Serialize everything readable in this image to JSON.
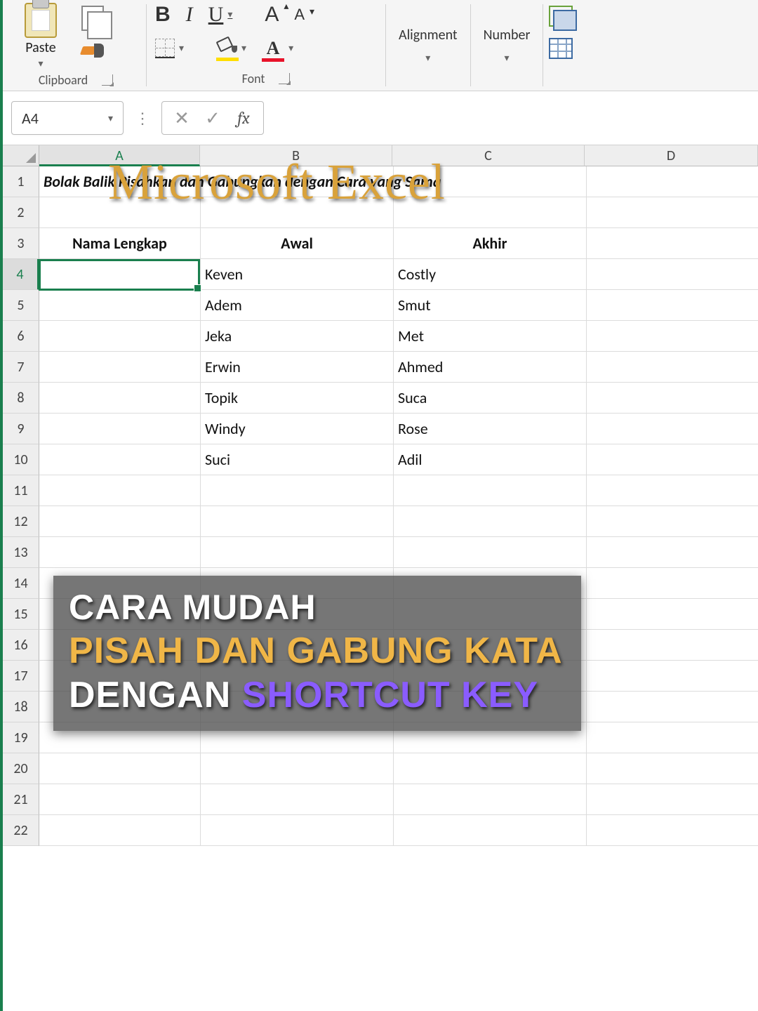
{
  "ribbon": {
    "paste_label": "Paste",
    "clipboard_label": "Clipboard",
    "bold": "B",
    "italic": "I",
    "underline": "U",
    "grow_font": "A",
    "shrink_font": "A",
    "font_color_letter": "A",
    "font_label": "Font",
    "alignment_label": "Alignment",
    "number_label": "Number"
  },
  "formula_bar": {
    "namebox_value": "A4",
    "cancel": "✕",
    "enter": "✓",
    "fx": "fx",
    "formula_value": ""
  },
  "overlay_title": "Microsoft Excel",
  "columns": [
    "A",
    "B",
    "C",
    "D"
  ],
  "sheet": {
    "row1": {
      "A": "Bolak Balik Pisahkan dan Gabungkan dengan Cara yang Sama"
    },
    "row3": {
      "A": "Nama Lengkap",
      "B": "Awal",
      "C": "Akhir"
    },
    "data_rows": [
      {
        "n": "4",
        "A": "",
        "B": "Keven",
        "C": "Costly"
      },
      {
        "n": "5",
        "A": "",
        "B": "Adem",
        "C": "Smut"
      },
      {
        "n": "6",
        "A": "",
        "B": "Jeka",
        "C": "Met"
      },
      {
        "n": "7",
        "A": "",
        "B": "Erwin",
        "C": "Ahmed"
      },
      {
        "n": "8",
        "A": "",
        "B": "Topik",
        "C": "Suca"
      },
      {
        "n": "9",
        "A": "",
        "B": "Windy",
        "C": "Rose"
      },
      {
        "n": "10",
        "A": "",
        "B": "Suci",
        "C": "Adil"
      }
    ],
    "empty_rows": [
      "11",
      "12",
      "13",
      "14",
      "15",
      "16",
      "17",
      "18",
      "19",
      "20",
      "21",
      "22"
    ]
  },
  "caption": {
    "line1": "CARA MUDAH",
    "line2": "PISAH DAN GABUNG KATA",
    "line3_white": "DENGAN ",
    "line3_purple": "SHORTCUT KEY"
  },
  "selection": {
    "cell": "A4"
  }
}
